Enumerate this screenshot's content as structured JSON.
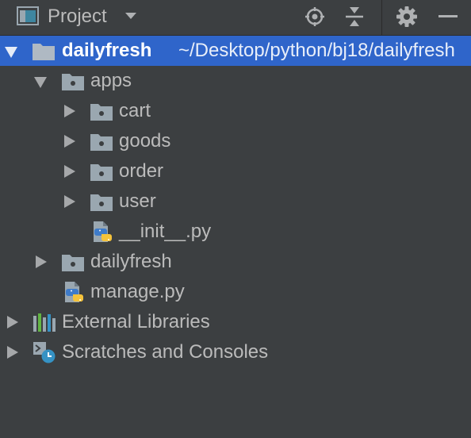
{
  "header": {
    "title": "Project",
    "view_icon": "project-view-icon",
    "dropdown_icon": "chevron-down-icon",
    "tools": [
      "locate-icon",
      "collapse-all-icon",
      "gear-icon",
      "hide-icon"
    ]
  },
  "tree": {
    "root": {
      "label": "dailyfresh",
      "path": "~/Desktop/python/bj18/dailyfresh",
      "icon": "folder-icon",
      "expanded": true
    },
    "apps": {
      "label": "apps",
      "icon": "package-icon",
      "expanded": true
    },
    "cart": {
      "label": "cart",
      "icon": "package-icon"
    },
    "goods": {
      "label": "goods",
      "icon": "package-icon"
    },
    "order": {
      "label": "order",
      "icon": "package-icon"
    },
    "user": {
      "label": "user",
      "icon": "package-icon"
    },
    "init": {
      "label": "__init__.py",
      "icon": "python-file-icon"
    },
    "dailyfresh_pkg": {
      "label": "dailyfresh",
      "icon": "package-icon"
    },
    "manage": {
      "label": "manage.py",
      "icon": "python-file-icon"
    },
    "external": {
      "label": "External Libraries",
      "icon": "library-icon"
    },
    "scratches": {
      "label": "Scratches and Consoles",
      "icon": "scratches-icon"
    }
  },
  "colors": {
    "background": "#3c3f41",
    "selection": "#2f65ca",
    "text": "#bbbbbb",
    "folder": "#9aa7b0",
    "python_blue": "#3e7bc9",
    "python_yellow": "#f5c33b"
  }
}
